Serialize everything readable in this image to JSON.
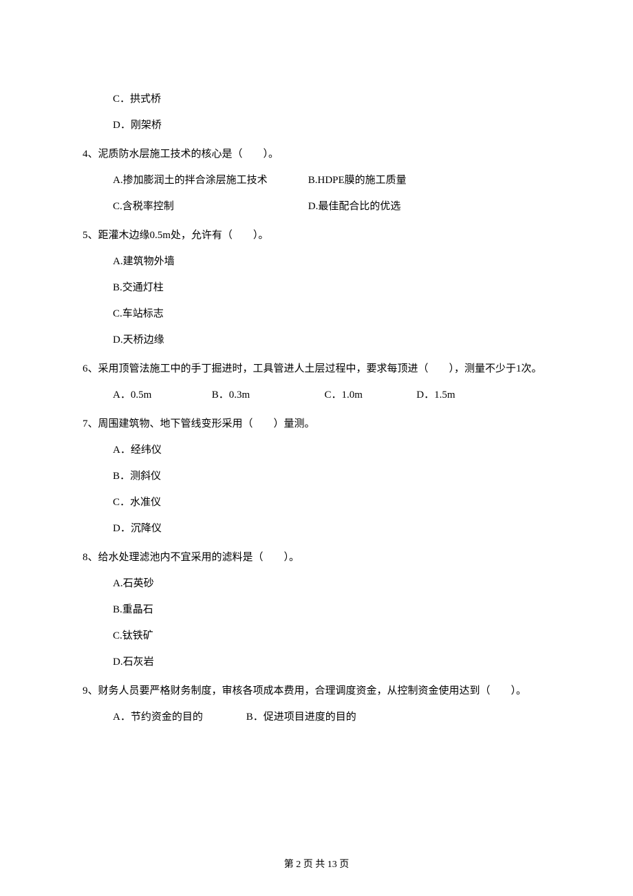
{
  "prev_options": {
    "c": "C．拱式桥",
    "d": "D．刚架桥"
  },
  "q4": {
    "stem": "4、泥质防水层施工技术的核心是（　　）。",
    "a": "A.掺加膨润土的拌合涂层施工技术",
    "b": "B.HDPE膜的施工质量",
    "c": "C.含税率控制",
    "d": "D.最佳配合比的优选"
  },
  "q5": {
    "stem": "5、距灌木边缘0.5m处，允许有（　　）。",
    "a": "A.建筑物外墙",
    "b": "B.交通灯柱",
    "c": "C.车站标志",
    "d": "D.天桥边缘"
  },
  "q6": {
    "stem": "6、采用顶管法施工中的手丁掘进时，工具管进人土层过程中，要求每顶进（　　），测量不少于1次。",
    "a": "A．0.5m",
    "b": "B．0.3m",
    "c": "C．1.0m",
    "d": "D．1.5m"
  },
  "q7": {
    "stem": "7、周围建筑物、地下管线变形采用（　　）量测。",
    "a": "A．经纬仪",
    "b": "B．测斜仪",
    "c": "C．水准仪",
    "d": "D．沉降仪"
  },
  "q8": {
    "stem": "8、给水处理滤池内不宜采用的滤料是（　　）。",
    "a": "A.石英砂",
    "b": "B.重晶石",
    "c": "C.钛铁矿",
    "d": "D.石灰岩"
  },
  "q9": {
    "stem": "9、财务人员要严格财务制度，审核各项成本费用，合理调度资金，从控制资金使用达到（　　）。",
    "a": "A．节约资金的目的",
    "b": "B．促进项目进度的目的"
  },
  "footer": "第 2 页 共 13 页"
}
